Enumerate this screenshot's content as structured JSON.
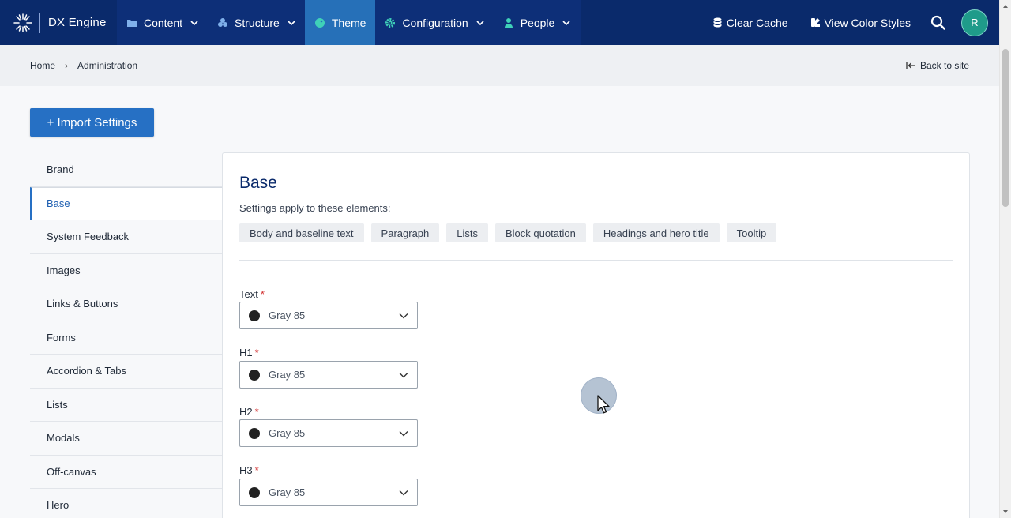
{
  "app": {
    "name": "DX Engine"
  },
  "nav": {
    "items": [
      {
        "label": "Content",
        "icon": "folder-icon",
        "has_dropdown": true,
        "active": false
      },
      {
        "label": "Structure",
        "icon": "sitemap-icon",
        "has_dropdown": true,
        "active": false
      },
      {
        "label": "Theme",
        "icon": "palette-icon",
        "has_dropdown": false,
        "active": true
      },
      {
        "label": "Configuration",
        "icon": "gear-icon",
        "has_dropdown": true,
        "active": false
      },
      {
        "label": "People",
        "icon": "person-icon",
        "has_dropdown": true,
        "active": false
      }
    ],
    "clear_cache": "Clear Cache",
    "view_color_styles": "View Color Styles",
    "avatar_initial": "R"
  },
  "breadcrumb": {
    "home": "Home",
    "current": "Administration",
    "back": "Back to site"
  },
  "import_button": "+ Import Settings",
  "sidebar": {
    "items": [
      {
        "label": "Brand",
        "active": false
      },
      {
        "label": "Base",
        "active": true
      },
      {
        "label": "System Feedback",
        "active": false
      },
      {
        "label": "Images",
        "active": false
      },
      {
        "label": "Links & Buttons",
        "active": false
      },
      {
        "label": "Forms",
        "active": false
      },
      {
        "label": "Accordion & Tabs",
        "active": false
      },
      {
        "label": "Lists",
        "active": false
      },
      {
        "label": "Modals",
        "active": false
      },
      {
        "label": "Off-canvas",
        "active": false
      },
      {
        "label": "Hero",
        "active": false
      }
    ]
  },
  "panel": {
    "title": "Base",
    "subtitle": "Settings apply to these elements:",
    "chips": [
      "Body and baseline text",
      "Paragraph",
      "Lists",
      "Block quotation",
      "Headings and hero title",
      "Tooltip"
    ],
    "fields": [
      {
        "label": "Text",
        "required": "*",
        "value": "Gray 85",
        "swatch": "#222222"
      },
      {
        "label": "H1",
        "required": "*",
        "value": "Gray 85",
        "swatch": "#222222"
      },
      {
        "label": "H2",
        "required": "*",
        "value": "Gray 85",
        "swatch": "#222222"
      },
      {
        "label": "H3",
        "required": "*",
        "value": "Gray 85",
        "swatch": "#222222"
      }
    ]
  },
  "colors": {
    "nav_bg": "#0a2a6b",
    "active_tab": "#2670b8",
    "primary": "#2670c4",
    "avatar": "#1f9b8a",
    "required": "#d12b2b"
  }
}
